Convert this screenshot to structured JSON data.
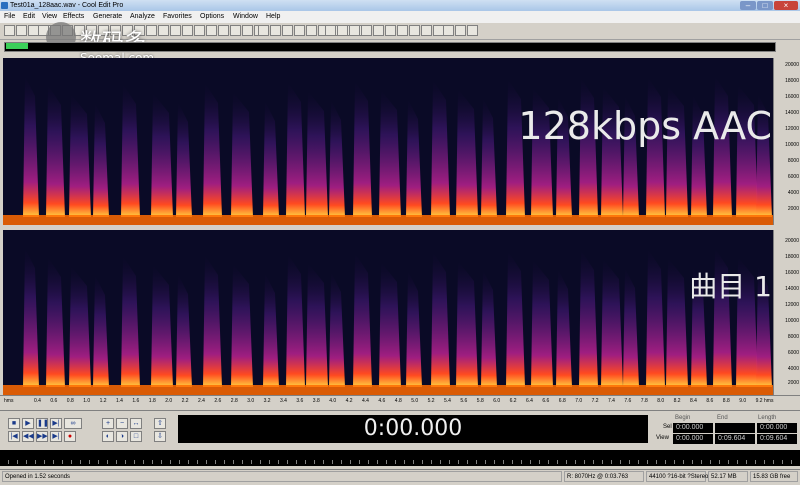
{
  "window": {
    "title": "Test01a_128aac.wav - Cool Edit Pro",
    "min": "–",
    "max": "□",
    "close": "×"
  },
  "menu": [
    "File",
    "Edit",
    "View",
    "Effects",
    "Generate",
    "Analyze",
    "Favorites",
    "Options",
    "Window",
    "Help"
  ],
  "watermark": {
    "cn": "数码多",
    "en": "Soomal.com"
  },
  "overlays": {
    "track1": "128kbps AAC",
    "track2": "曲目 1"
  },
  "freq_axis": [
    "20000",
    "18000",
    "16000",
    "14000",
    "12000",
    "10000",
    "8000",
    "6000",
    "4000",
    "2000"
  ],
  "timeline": {
    "unit": "hms",
    "ticks": [
      "0.4",
      "0.6",
      "0.8",
      "1.0",
      "1.2",
      "1.4",
      "1.6",
      "1.8",
      "2.0",
      "2.2",
      "2.4",
      "2.6",
      "2.8",
      "3.0",
      "3.2",
      "3.4",
      "3.6",
      "3.8",
      "4.0",
      "4.2",
      "4.4",
      "4.6",
      "4.8",
      "5.0",
      "5.2",
      "5.4",
      "5.6",
      "5.8",
      "6.0",
      "6.2",
      "6.4",
      "6.6",
      "6.8",
      "7.0",
      "7.2",
      "7.4",
      "7.6",
      "7.8",
      "8.0",
      "8.2",
      "8.4",
      "8.6",
      "8.8",
      "9.0",
      "9.2"
    ],
    "end": "hms"
  },
  "transport": {
    "time": "0:00.000"
  },
  "selection": {
    "headers": [
      "Begin",
      "End",
      "Length"
    ],
    "sel": {
      "label": "Sel",
      "begin": "0:00.000",
      "end": "",
      "length": "0:00.000"
    },
    "view": {
      "label": "View",
      "begin": "0:00.000",
      "end": "0:09.604",
      "length": "0:09.604"
    }
  },
  "status": {
    "opened": "Opened in 1.52 seconds",
    "cursor": "R: 8070Hz @ 0:03.763",
    "format": "44100 ?16-bit ?Stereo",
    "size": "52.17 MB",
    "free": "15.83 GB free"
  },
  "colors": {
    "spec_bg": "#0a0a26",
    "spec_burst": "#7b1fa0",
    "spec_low": "#ff6a00",
    "overview_sel": "#3cd05a"
  }
}
